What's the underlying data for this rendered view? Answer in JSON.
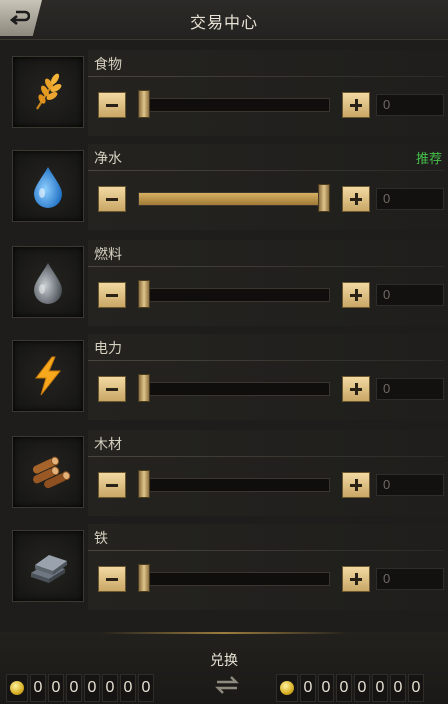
{
  "header": {
    "title": "交易中心"
  },
  "resources": [
    {
      "name": "食物",
      "recommend": "",
      "qty": "0",
      "fill": 0.0
    },
    {
      "name": "净水",
      "recommend": "推荐",
      "qty": "0",
      "fill": 1.0
    },
    {
      "name": "燃料",
      "recommend": "",
      "qty": "0",
      "fill": 0.0
    },
    {
      "name": "电力",
      "recommend": "",
      "qty": "0",
      "fill": 0.0
    },
    {
      "name": "木材",
      "recommend": "",
      "qty": "0",
      "fill": 0.0
    },
    {
      "name": "铁",
      "recommend": "",
      "qty": "0",
      "fill": 0.0
    }
  ],
  "footer": {
    "exchange_label": "兑换",
    "left_digits": [
      "0",
      "0",
      "0",
      "0",
      "0",
      "0",
      "0"
    ],
    "right_digits": [
      "0",
      "0",
      "0",
      "0",
      "0",
      "0",
      "0"
    ]
  },
  "icons": [
    "wheat-icon",
    "water-drop-icon",
    "oil-drop-icon",
    "lightning-icon",
    "wood-logs-icon",
    "iron-ingot-icon"
  ],
  "colors": {
    "accent": "#d8b064",
    "recommend": "#46c04a",
    "button": "#e6c98c"
  }
}
